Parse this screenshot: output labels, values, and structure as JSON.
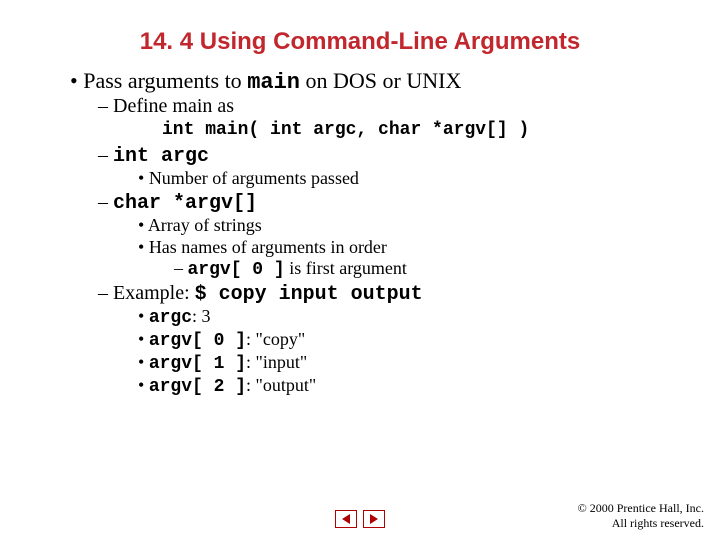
{
  "title": "14. 4   Using Command-Line Arguments",
  "l1": {
    "pre": "Pass arguments to ",
    "code": "main",
    "post": " on DOS or UNIX"
  },
  "l2": "Define main as",
  "sig": "int main( int argc, char *argv[] )",
  "l3": "int argc",
  "l3a": "Number of arguments passed",
  "l4": "char *argv[]",
  "l4a": "Array of strings",
  "l4b": "Has names of arguments in order",
  "l4c": {
    "code": "argv[ 0 ]",
    "post": " is first argument"
  },
  "l5": {
    "pre": "Example: ",
    "code": "$ copy input output"
  },
  "l5a": {
    "code": "argc",
    "post": ": 3"
  },
  "l5b": {
    "code": "argv[ 0 ]",
    "post": ": \"copy\""
  },
  "l5c": {
    "code": "argv[ 1 ]",
    "post": ": \"input\""
  },
  "l5d": {
    "code": "argv[ 2 ]",
    "post": ": \"output\""
  },
  "footer1": "© 2000 Prentice Hall, Inc.",
  "footer2": "All rights reserved."
}
